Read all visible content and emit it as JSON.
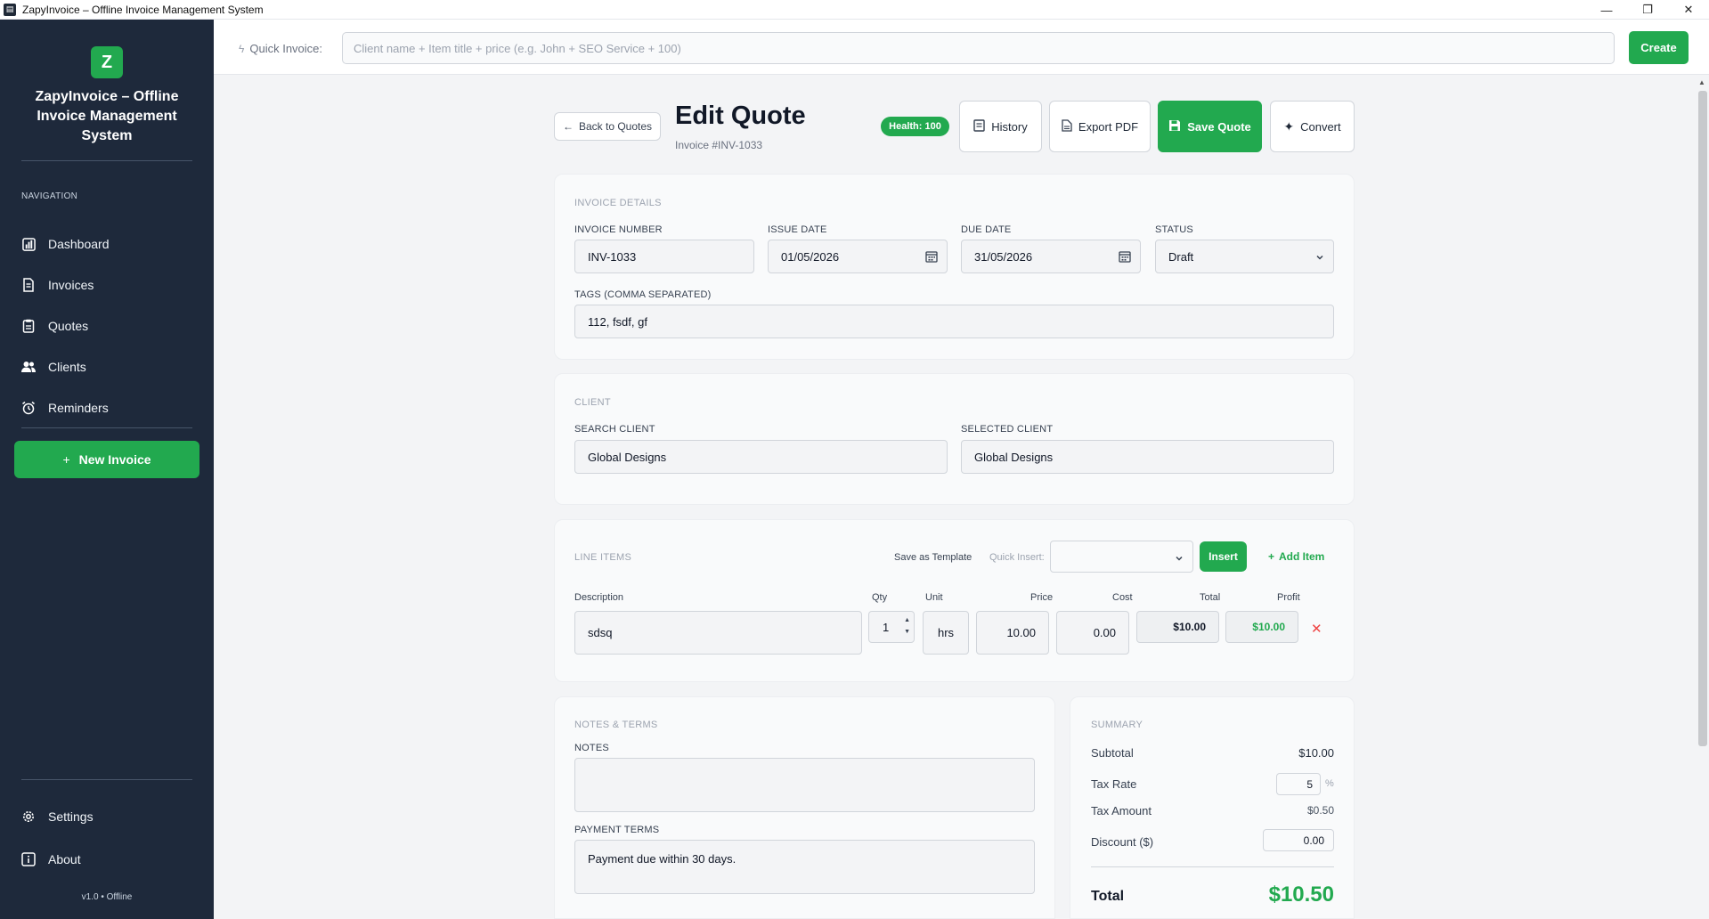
{
  "window": {
    "title": "ZapyInvoice – Offline Invoice Management System",
    "minimize": "—",
    "maximize": "❐",
    "close": "✕"
  },
  "sidebar": {
    "logo_letter": "Z",
    "brand": "ZapyInvoice – Offline Invoice Management System",
    "nav_label": "NAVIGATION",
    "items": [
      {
        "label": "Dashboard",
        "icon": "chart-icon"
      },
      {
        "label": "Invoices",
        "icon": "document-icon"
      },
      {
        "label": "Quotes",
        "icon": "clipboard-icon"
      },
      {
        "label": "Clients",
        "icon": "users-icon"
      },
      {
        "label": "Reminders",
        "icon": "alarm-icon"
      }
    ],
    "new_invoice": "New Invoice",
    "settings": "Settings",
    "about": "About",
    "version": "v1.0 • Offline"
  },
  "quick": {
    "label": "Quick Invoice:",
    "placeholder": "Client name + Item title + price (e.g. John + SEO Service + 100)",
    "create": "Create"
  },
  "header": {
    "back": "Back to Quotes",
    "title": "Edit Quote",
    "subtitle": "Invoice #INV-1033",
    "health": "Health: 100",
    "history": "History",
    "export_pdf": "Export PDF",
    "save": "Save Quote",
    "convert": "Convert"
  },
  "details": {
    "title": "INVOICE DETAILS",
    "invoice_number_label": "INVOICE NUMBER",
    "invoice_number": "INV-1033",
    "issue_date_label": "ISSUE DATE",
    "issue_date": "01/05/2026",
    "due_date_label": "DUE DATE",
    "due_date": "31/05/2026",
    "status_label": "STATUS",
    "status": "Draft",
    "tags_label": "TAGS (COMMA SEPARATED)",
    "tags": "112, fsdf, gf"
  },
  "client": {
    "title": "CLIENT",
    "search_label": "SEARCH CLIENT",
    "search_value": "Global Designs",
    "selected_label": "SELECTED CLIENT",
    "selected_value": "Global Designs"
  },
  "line_items": {
    "title": "LINE ITEMS",
    "save_template": "Save as Template",
    "quick_insert_label": "Quick Insert:",
    "insert": "Insert",
    "add_item": "Add Item",
    "headers": {
      "description": "Description",
      "qty": "Qty",
      "unit": "Unit",
      "price": "Price",
      "cost": "Cost",
      "total": "Total",
      "profit": "Profit"
    },
    "rows": [
      {
        "description": "sdsq",
        "qty": "1",
        "unit": "hrs",
        "price": "10.00",
        "cost": "0.00",
        "total": "$10.00",
        "profit": "$10.00"
      }
    ]
  },
  "notes": {
    "title": "NOTES & TERMS",
    "notes_label": "NOTES",
    "notes_value": "",
    "terms_label": "PAYMENT TERMS",
    "terms_value": "Payment due within 30 days."
  },
  "summary": {
    "title": "SUMMARY",
    "subtotal_label": "Subtotal",
    "subtotal": "$10.00",
    "tax_rate_label": "Tax Rate",
    "tax_rate": "5",
    "tax_rate_unit": "%",
    "tax_amount_label": "Tax Amount",
    "tax_amount": "$0.50",
    "discount_label": "Discount ($)",
    "discount": "0.00",
    "total_label": "Total",
    "total": "$10.50"
  },
  "colors": {
    "accent": "#22a94f",
    "sidebar": "#1e293b",
    "danger": "#ef4444"
  }
}
